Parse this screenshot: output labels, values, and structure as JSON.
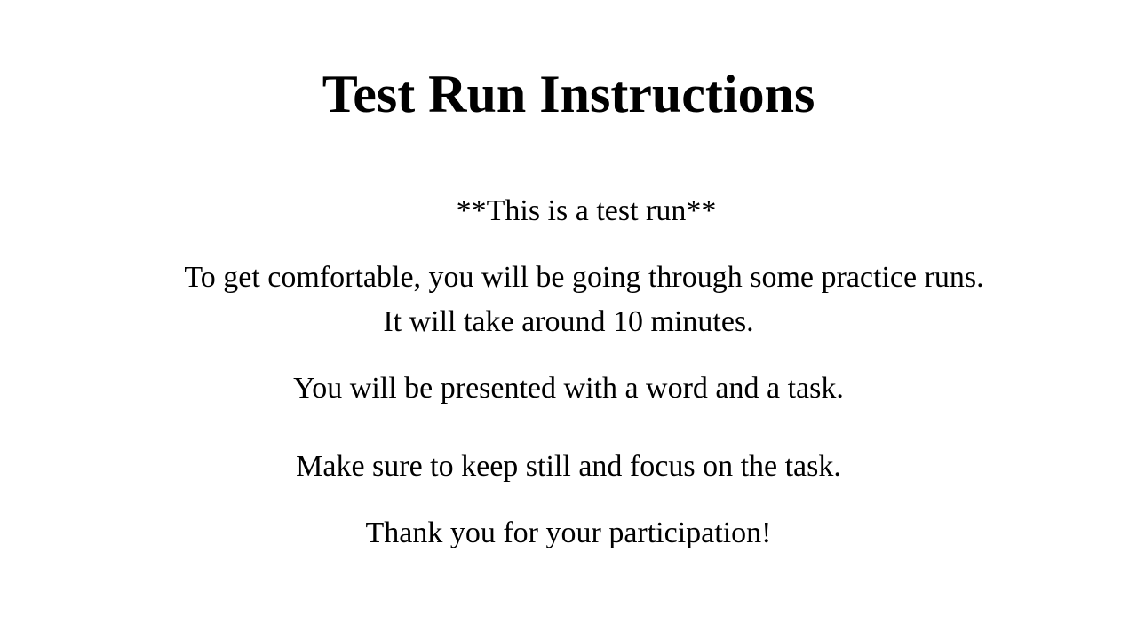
{
  "slide": {
    "title": "Test Run Instructions",
    "lines": {
      "test_run": "**This is a test run**",
      "comfortable": "To get comfortable, you will be going through some practice runs.",
      "duration": "It will take around 10 minutes.",
      "presented": "You will be presented with a word and a task.",
      "keep_still": "Make sure to keep still and focus on the task.",
      "thanks": "Thank you for your participation!"
    }
  }
}
